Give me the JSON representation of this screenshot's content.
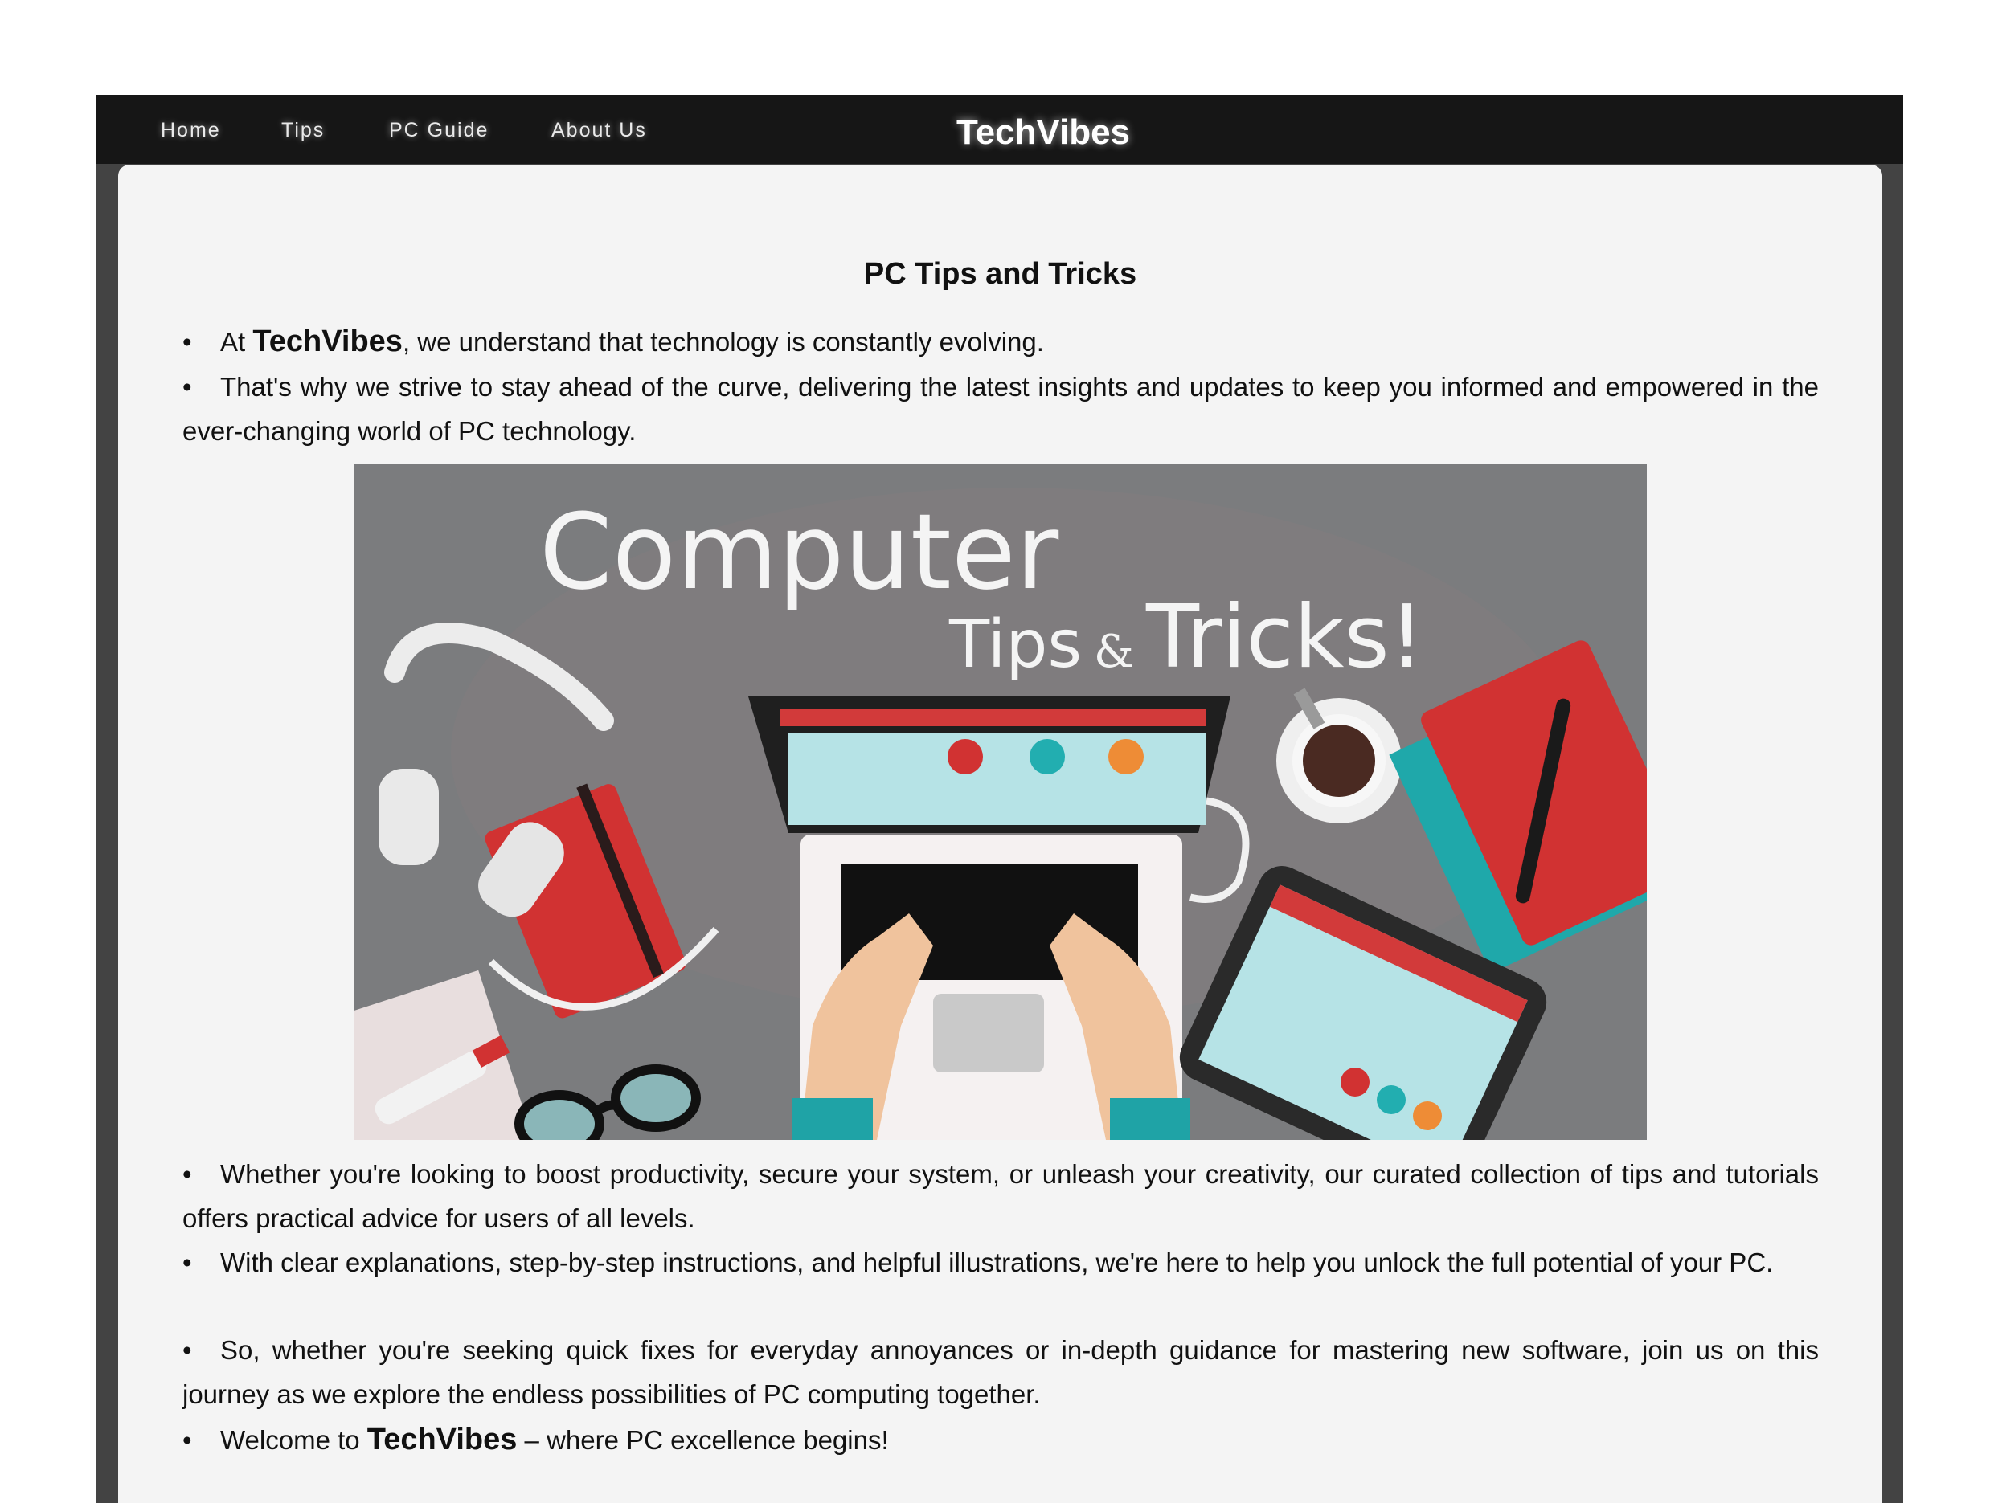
{
  "nav": {
    "items": [
      {
        "label": "Home"
      },
      {
        "label": "Tips"
      },
      {
        "label": "PC Guide"
      },
      {
        "label": "About Us"
      }
    ],
    "brand": "TechVibes"
  },
  "main": {
    "heading": "PC Tips and Tricks",
    "intro": [
      {
        "pre": "At ",
        "bold": "TechVibes",
        "post": ", we understand that technology is constantly evolving."
      },
      {
        "text": "That's why we strive to stay ahead of the curve, delivering the latest insights and updates to keep you informed and empowered in the ever-changing world of PC technology."
      }
    ],
    "image": {
      "title_line1": "Computer",
      "title_tips": "Tips",
      "title_amp": "&",
      "title_tricks": "Tricks!"
    },
    "body": [
      {
        "text": "Whether you're looking to boost productivity, secure your system, or unleash your creativity, our curated collection of tips and tutorials offers practical advice for users of all levels."
      },
      {
        "text": "With clear explanations, step-by-step instructions, and helpful illustrations, we're here to help you unlock the full potential of your PC."
      },
      {
        "text": "So, whether you're seeking quick fixes for everyday annoyances or in-depth guidance for mastering new software, join us on this journey as we explore the endless possibilities of PC computing together."
      }
    ],
    "closing": {
      "pre": "Welcome to ",
      "bold": "TechVibes",
      "post": " – where PC excellence begins!"
    },
    "bullet": "•"
  },
  "colors": {
    "frame": "#434343",
    "topbar": "#161616",
    "panel": "#f4f4f4",
    "image_bg": "#7b7c7e",
    "accent_red": "#d03030",
    "accent_teal": "#22aeb0",
    "accent_orange": "#ee8c36"
  }
}
